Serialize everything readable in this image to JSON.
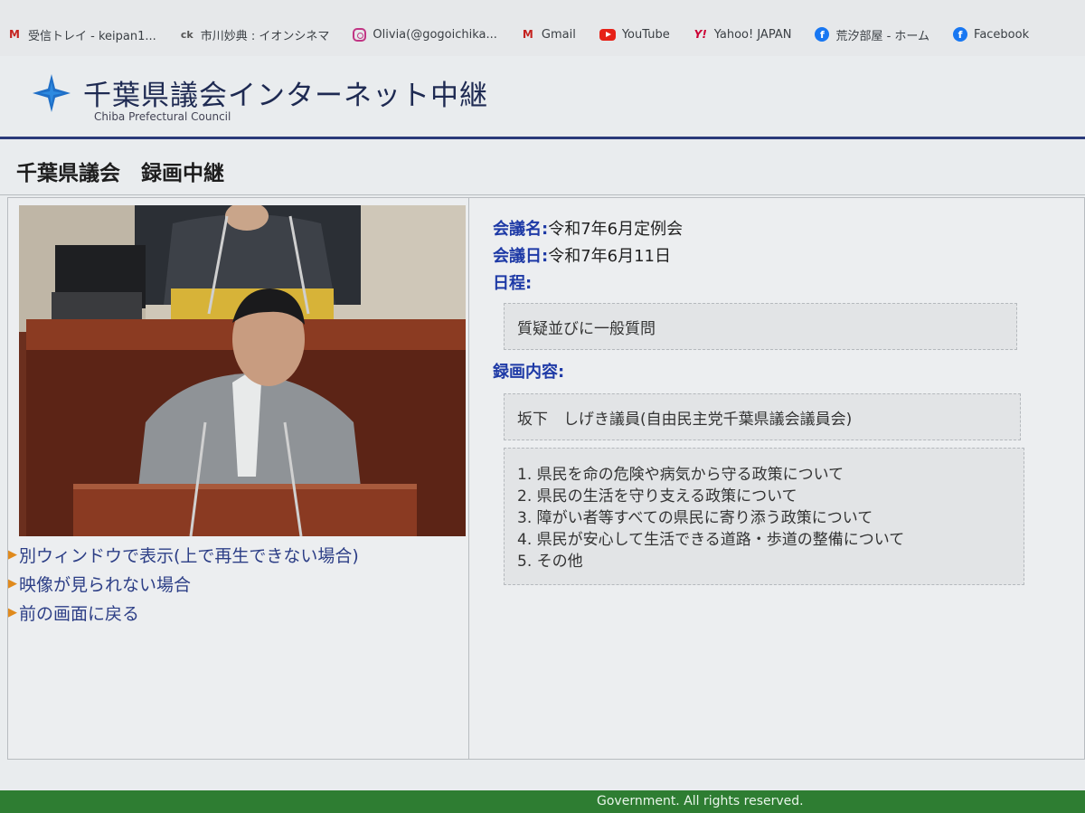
{
  "bookmarks": [
    {
      "icon": "gmail-icon",
      "label": "受信トレイ - keipan1..."
    },
    {
      "icon": "cinema-icon",
      "label": "市川妙典 : イオンシネマ"
    },
    {
      "icon": "instagram-icon",
      "label": "Olivia(@gogoichika..."
    },
    {
      "icon": "gmail-icon",
      "label": "Gmail"
    },
    {
      "icon": "youtube-icon",
      "label": "YouTube"
    },
    {
      "icon": "yahoo-icon",
      "label": "Yahoo! JAPAN"
    },
    {
      "icon": "facebook-icon",
      "label": "荒汐部屋 - ホーム"
    },
    {
      "icon": "facebook-icon",
      "label": "Facebook"
    }
  ],
  "header": {
    "title": "千葉県議会インターネット中継",
    "subtitle": "Chiba Prefectural Council"
  },
  "page_heading": "千葉県議会　録画中継",
  "links": [
    "別ウィンドウで表示(上で再生できない場合)",
    "映像が見られない場合",
    "前の画面に戻る"
  ],
  "meeting": {
    "name_label": "会議名:",
    "name": "令和7年6月定例会",
    "date_label": "会議日:",
    "date": "令和7年6月11日",
    "schedule_label": "日程:",
    "schedule": "質疑並びに一般質問",
    "content_label": "録画内容:",
    "member": "坂下　しげき議員(自由民主党千葉県議会議員会)",
    "topics": [
      "1. 県民を命の危険や病気から守る政策について",
      "2. 県民の生活を守り支える政策について",
      "3. 障がい者等すべての県民に寄り添う政策について",
      "4. 県民が安心して生活できる道路・歩道の整備について",
      "5. その他"
    ]
  },
  "footer": "Government. All rights reserved.",
  "colors": {
    "accent_blue": "#1e3aa6",
    "header_rule": "#2a3a7a",
    "footer_green": "#2e7d32",
    "link_arrow": "#e08a1c"
  }
}
